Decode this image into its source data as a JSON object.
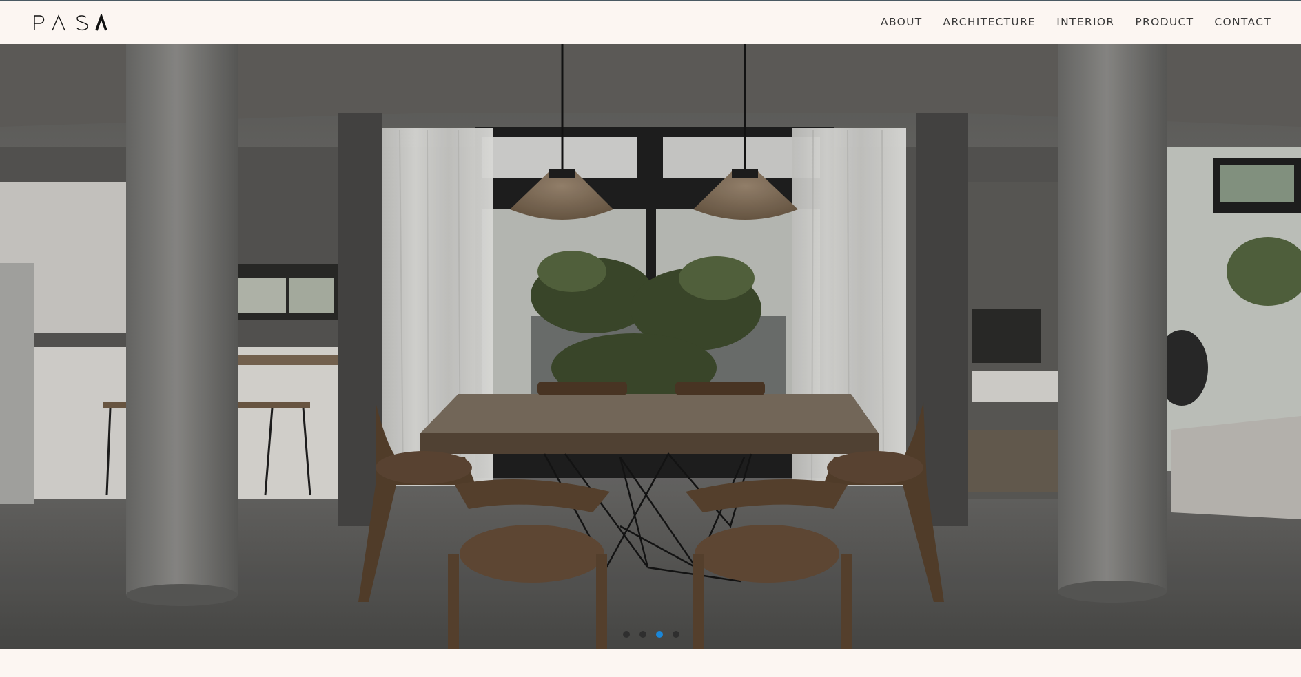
{
  "brand": {
    "logo_text": "PASA"
  },
  "nav": {
    "items": [
      {
        "label": "ABOUT"
      },
      {
        "label": "ARCHITECTURE"
      },
      {
        "label": "INTERIOR"
      },
      {
        "label": "PRODUCT"
      },
      {
        "label": "CONTACT"
      }
    ]
  },
  "slider": {
    "slide_count": 4,
    "active_slide": 3
  },
  "colors": {
    "background": "#fcf6f2",
    "nav_text": "#3a3a3a",
    "dot_active": "#1a87d9",
    "dot_inactive": "#2f2f2f"
  }
}
